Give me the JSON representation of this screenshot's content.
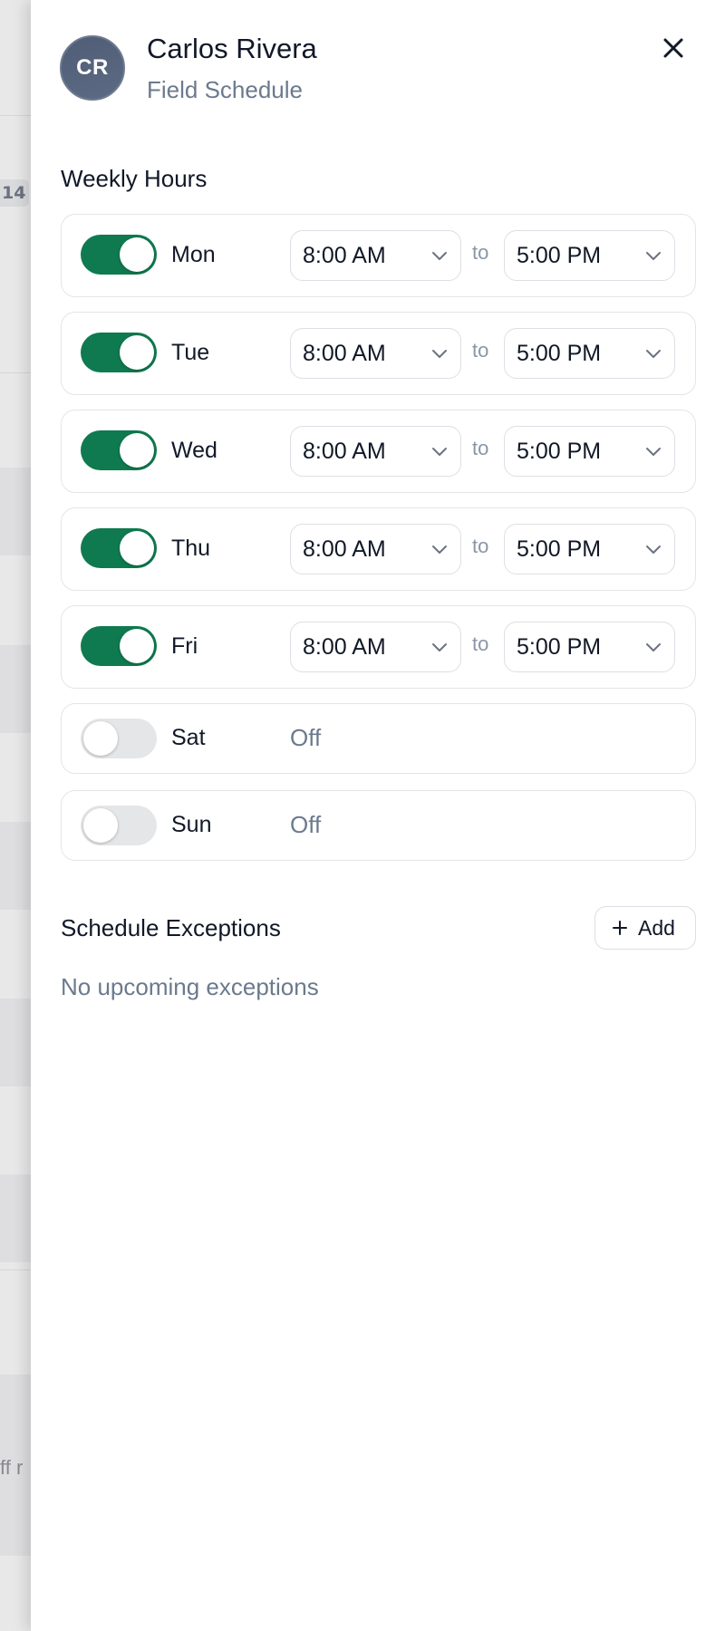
{
  "background": {
    "badge_text": "14",
    "partial_text": "ff r"
  },
  "drawer": {
    "avatar_initials": "CR",
    "name": "Carlos Rivera",
    "subtitle": "Field Schedule",
    "close_icon": "close-icon"
  },
  "weekly_hours": {
    "title": "Weekly Hours",
    "to_label": "to",
    "off_label": "Off",
    "days": [
      {
        "label": "Mon",
        "enabled": true,
        "start": "8:00 AM",
        "end": "5:00 PM"
      },
      {
        "label": "Tue",
        "enabled": true,
        "start": "8:00 AM",
        "end": "5:00 PM"
      },
      {
        "label": "Wed",
        "enabled": true,
        "start": "8:00 AM",
        "end": "5:00 PM"
      },
      {
        "label": "Thu",
        "enabled": true,
        "start": "8:00 AM",
        "end": "5:00 PM"
      },
      {
        "label": "Fri",
        "enabled": true,
        "start": "8:00 AM",
        "end": "5:00 PM"
      },
      {
        "label": "Sat",
        "enabled": false,
        "status": "Off"
      },
      {
        "label": "Sun",
        "enabled": false,
        "status": "Off"
      }
    ]
  },
  "exceptions": {
    "title": "Schedule Exceptions",
    "add_label": "Add",
    "add_icon": "plus-icon",
    "empty_text": "No upcoming exceptions"
  },
  "colors": {
    "toggle_on": "#0f7a4f",
    "toggle_off": "#e5e6e8",
    "avatar": "#536179"
  }
}
